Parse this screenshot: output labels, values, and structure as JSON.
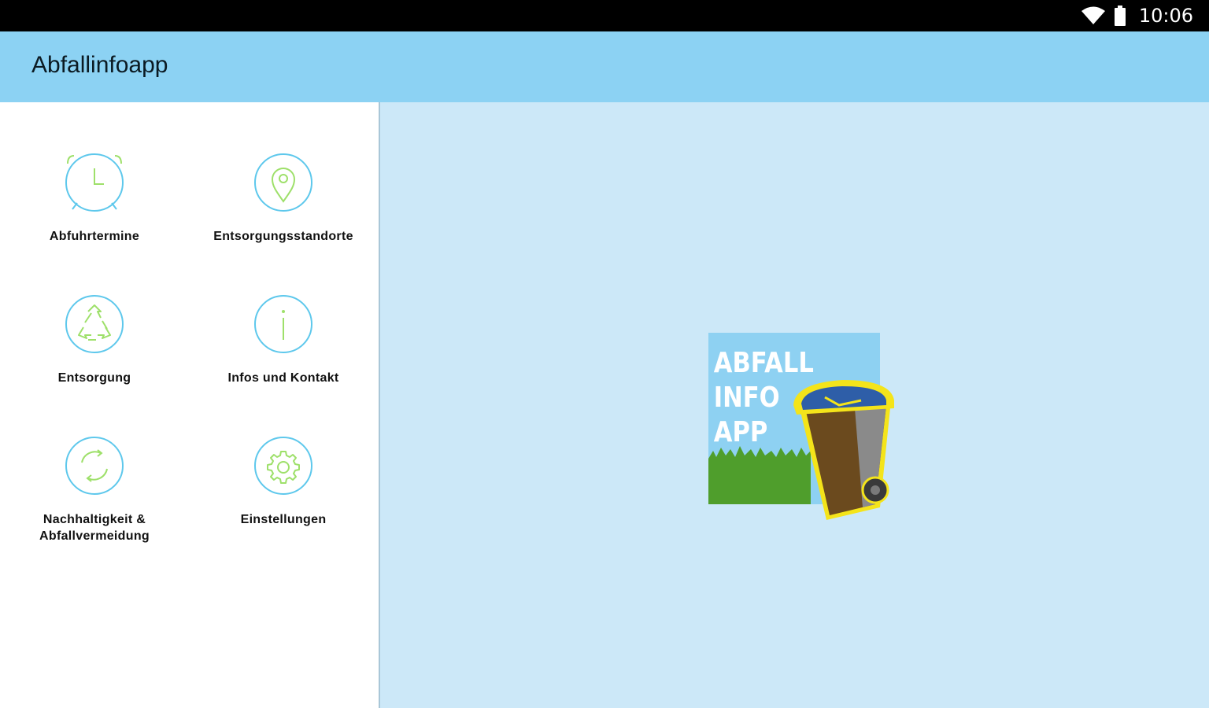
{
  "status_bar": {
    "time": "10:06",
    "icons": [
      "wifi-icon",
      "battery-icon"
    ]
  },
  "app_bar": {
    "title": "Abfallinfoapp"
  },
  "menu": {
    "items": [
      {
        "label": "Abfuhrtermine",
        "icon": "alarm-clock-icon"
      },
      {
        "label": "Entsorgungsstandorte",
        "icon": "location-pin-icon"
      },
      {
        "label": "Entsorgung",
        "icon": "recycle-icon"
      },
      {
        "label": "Infos und Kontakt",
        "icon": "info-icon"
      },
      {
        "label": "Nachhaltigkeit & Abfallvermeidung",
        "icon": "cycle-arrows-icon"
      },
      {
        "label": "Einstellungen",
        "icon": "gear-icon"
      }
    ]
  },
  "logo": {
    "lines": [
      "ABFALL",
      "INFO",
      "APP"
    ]
  },
  "colors": {
    "app_bar": "#8cd2f3",
    "right_pane": "#cce8f8",
    "icon_ring": "#5ec8ec",
    "icon_glyph": "#9ee06a",
    "logo_sky": "#8ed1f2",
    "logo_grass": "#4f9e2c",
    "bin_lid": "#2e5ea8",
    "bin_body": "#6b4a1e",
    "bin_outline": "#f4e41a"
  }
}
